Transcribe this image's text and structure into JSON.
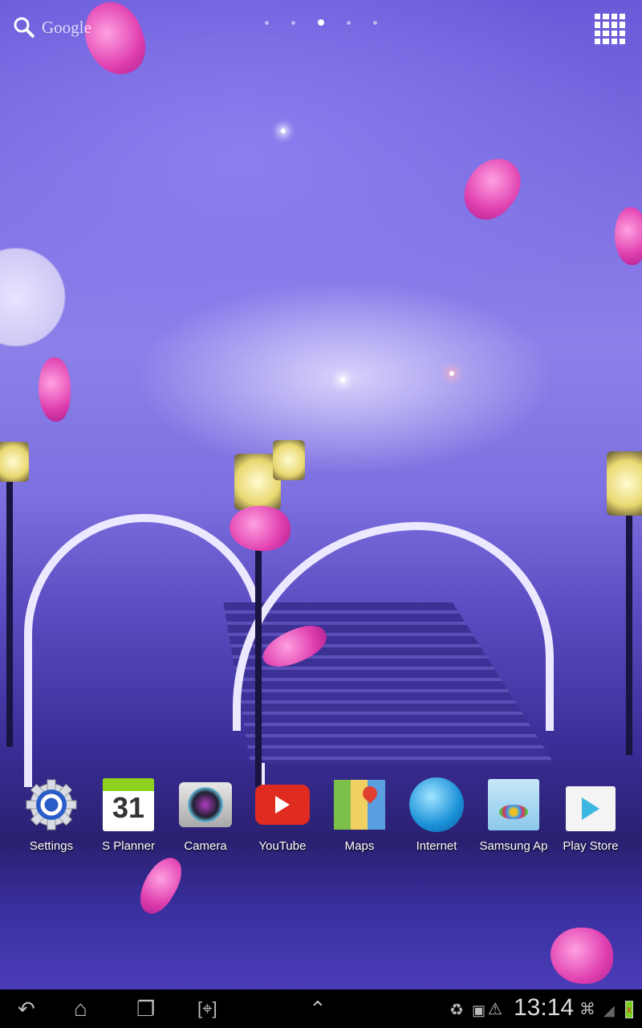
{
  "search": {
    "label": "Google",
    "icon": "search-icon"
  },
  "home_pages": {
    "count": 5,
    "active": 2
  },
  "apps_button": {
    "icon": "apps-grid-icon"
  },
  "dock": [
    {
      "label": "Settings",
      "icon": "settings-gear-icon"
    },
    {
      "label": "S Planner",
      "icon": "calendar-icon",
      "day": "31"
    },
    {
      "label": "Camera",
      "icon": "camera-icon"
    },
    {
      "label": "YouTube",
      "icon": "youtube-icon"
    },
    {
      "label": "Maps",
      "icon": "maps-icon"
    },
    {
      "label": "Internet",
      "icon": "globe-icon"
    },
    {
      "label": "Samsung Ap",
      "icon": "samsung-apps-icon"
    },
    {
      "label": "Play Store",
      "icon": "play-store-icon"
    }
  ],
  "navbar": {
    "back": "back-icon",
    "home": "home-icon",
    "recents": "recent-apps-icon",
    "screenshot": "screenshot-icon",
    "up": "chevron-up-icon"
  },
  "status": {
    "time": "13:14",
    "icons": [
      "recycle-icon",
      "sd-card-icon",
      "warning-icon",
      "wifi-icon",
      "signal-icon",
      "battery-icon"
    ]
  },
  "colors": {
    "accent_purple": "#6a5ad8",
    "navbar": "#000000",
    "youtube_red": "#e02b20"
  }
}
